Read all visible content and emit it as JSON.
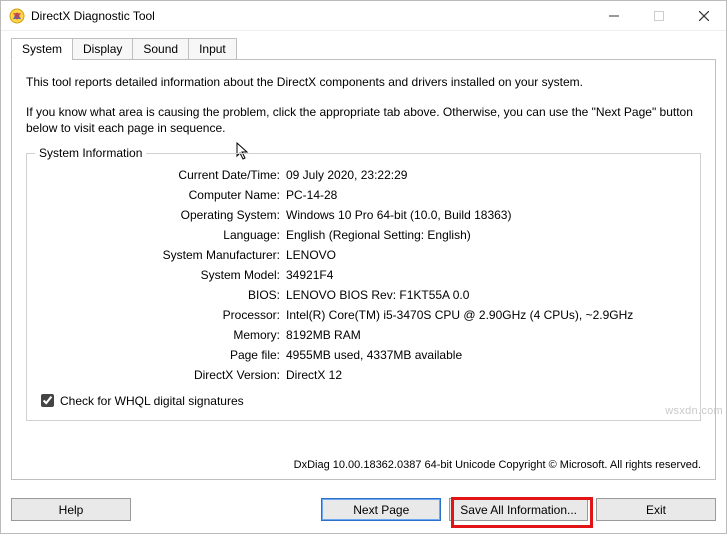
{
  "window": {
    "title": "DirectX Diagnostic Tool"
  },
  "tabs": {
    "system": "System",
    "display": "Display",
    "sound": "Sound",
    "input": "Input"
  },
  "intro1": "This tool reports detailed information about the DirectX components and drivers installed on your system.",
  "intro2": "If you know what area is causing the problem, click the appropriate tab above.  Otherwise, you can use the \"Next Page\" button below to visit each page in sequence.",
  "group": {
    "title": "System Information"
  },
  "labels": {
    "datetime": "Current Date/Time:",
    "computer": "Computer Name:",
    "os": "Operating System:",
    "lang": "Language:",
    "manufacturer": "System Manufacturer:",
    "model": "System Model:",
    "bios": "BIOS:",
    "processor": "Processor:",
    "memory": "Memory:",
    "pagefile": "Page file:",
    "dx": "DirectX Version:"
  },
  "values": {
    "datetime": "09 July 2020, 23:22:29",
    "computer": "PC-14-28",
    "os": "Windows 10 Pro 64-bit (10.0, Build 18363)",
    "lang": "English (Regional Setting: English)",
    "manufacturer": "LENOVO",
    "model": "34921F4",
    "bios": "LENOVO BIOS Rev: F1KT55A 0.0",
    "processor": "Intel(R) Core(TM) i5-3470S CPU @ 2.90GHz (4 CPUs), ~2.9GHz",
    "memory": "8192MB RAM",
    "pagefile": "4955MB used, 4337MB available",
    "dx": "DirectX 12"
  },
  "whql_label": "Check for WHQL digital signatures",
  "footer_small": "DxDiag 10.00.18362.0387 64-bit Unicode   Copyright © Microsoft. All rights reserved.",
  "buttons": {
    "help": "Help",
    "next": "Next Page",
    "save": "Save All Information...",
    "exit": "Exit"
  },
  "watermark": "wsxdn.com"
}
